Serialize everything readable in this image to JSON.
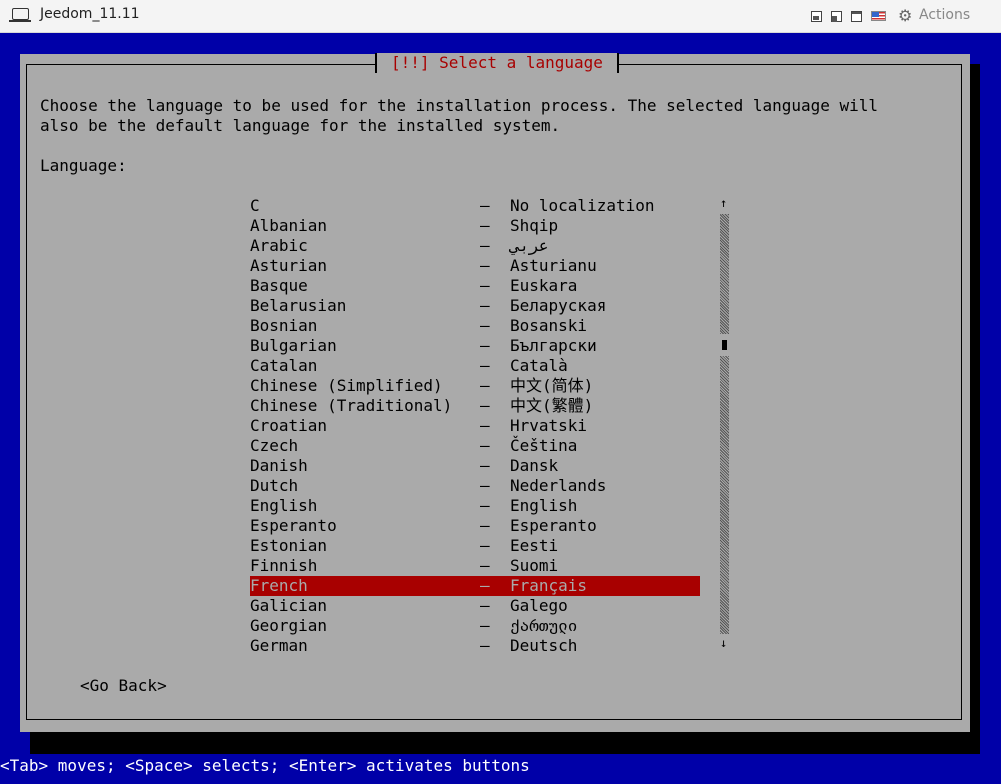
{
  "window": {
    "title": "Jeedom_11.11",
    "actions_label": "Actions",
    "icons": [
      "vm-icon",
      "layout-a-icon",
      "layout-b-icon",
      "layout-c-icon",
      "us-flag-icon",
      "gear-icon"
    ]
  },
  "dialog": {
    "title": "[!!] Select a language",
    "description": "Choose the language to be used for the installation process. The selected language will\nalso be the default language for the installed system.",
    "language_label": "Language:",
    "go_back": "<Go Back>",
    "selected_index": 18,
    "languages": [
      {
        "name": "C",
        "native": "No localization"
      },
      {
        "name": "Albanian",
        "native": "Shqip"
      },
      {
        "name": "Arabic",
        "native": "عربي"
      },
      {
        "name": "Asturian",
        "native": "Asturianu"
      },
      {
        "name": "Basque",
        "native": "Euskara"
      },
      {
        "name": "Belarusian",
        "native": "Беларуская"
      },
      {
        "name": "Bosnian",
        "native": "Bosanski"
      },
      {
        "name": "Bulgarian",
        "native": "Български"
      },
      {
        "name": "Catalan",
        "native": "Català"
      },
      {
        "name": "Chinese (Simplified)",
        "native": "中文(简体)"
      },
      {
        "name": "Chinese (Traditional)",
        "native": "中文(繁體)"
      },
      {
        "name": "Croatian",
        "native": "Hrvatski"
      },
      {
        "name": "Czech",
        "native": "Čeština"
      },
      {
        "name": "Danish",
        "native": "Dansk"
      },
      {
        "name": "Dutch",
        "native": "Nederlands"
      },
      {
        "name": "English",
        "native": "English"
      },
      {
        "name": "Esperanto",
        "native": "Esperanto"
      },
      {
        "name": "Estonian",
        "native": "Eesti"
      },
      {
        "name": "Finnish",
        "native": "Suomi"
      },
      {
        "name": "French",
        "native": "Français"
      },
      {
        "name": "Galician",
        "native": "Galego"
      },
      {
        "name": "Georgian",
        "native": "ქართული"
      },
      {
        "name": "German",
        "native": "Deutsch"
      }
    ],
    "dash": "–",
    "scroll_up": "↑",
    "scroll_down": "↓"
  },
  "status_bar": "<Tab> moves; <Space> selects; <Enter> activates buttons"
}
